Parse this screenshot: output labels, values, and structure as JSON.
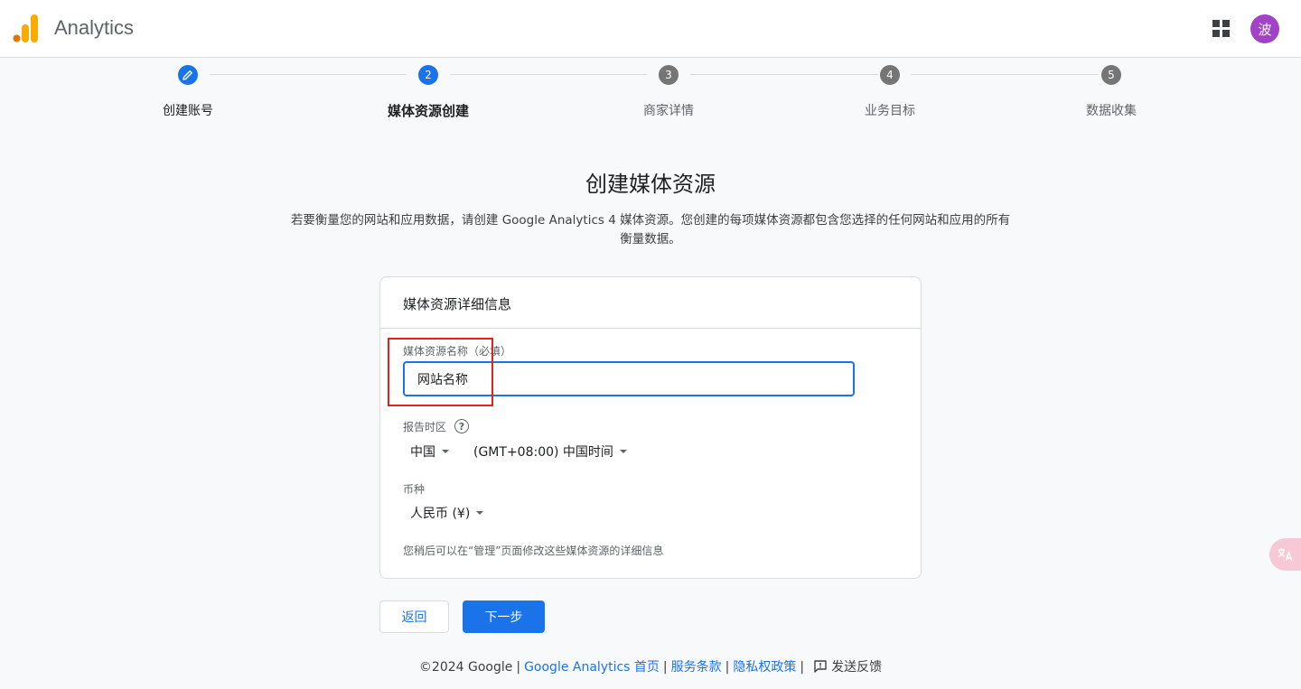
{
  "header": {
    "app_title": "Analytics",
    "avatar_letter": "波"
  },
  "stepper": {
    "steps": [
      {
        "number": "",
        "label": "创建账号",
        "state": "done"
      },
      {
        "number": "2",
        "label": "媒体资源创建",
        "state": "current"
      },
      {
        "number": "3",
        "label": "商家详情",
        "state": "upcoming"
      },
      {
        "number": "4",
        "label": "业务目标",
        "state": "upcoming"
      },
      {
        "number": "5",
        "label": "数据收集",
        "state": "upcoming"
      }
    ]
  },
  "main": {
    "title": "创建媒体资源",
    "description": "若要衡量您的网站和应用数据，请创建 Google Analytics 4 媒体资源。您创建的每项媒体资源都包含您选择的任何网站和应用的所有衡量数据。"
  },
  "card": {
    "title": "媒体资源详细信息",
    "name_label": "媒体资源名称（必填）",
    "name_value": "网站名称",
    "timezone_label": "报告时区",
    "country_value": "中国",
    "timezone_value": "(GMT+08:00) 中国时间",
    "currency_label": "币种",
    "currency_value": "人民币 (¥)",
    "note": "您稍后可以在“管理”页面修改这些媒体资源的详细信息"
  },
  "buttons": {
    "back": "返回",
    "next": "下一步"
  },
  "footer": {
    "copyright": "©2024 Google",
    "links": [
      "Google Analytics 首页",
      "服务条款",
      "隐私权政策"
    ],
    "feedback": "发送反馈"
  },
  "colors": {
    "accent": "#1a73e8",
    "avatar": "#a142c9",
    "highlight": "#e5211c"
  }
}
